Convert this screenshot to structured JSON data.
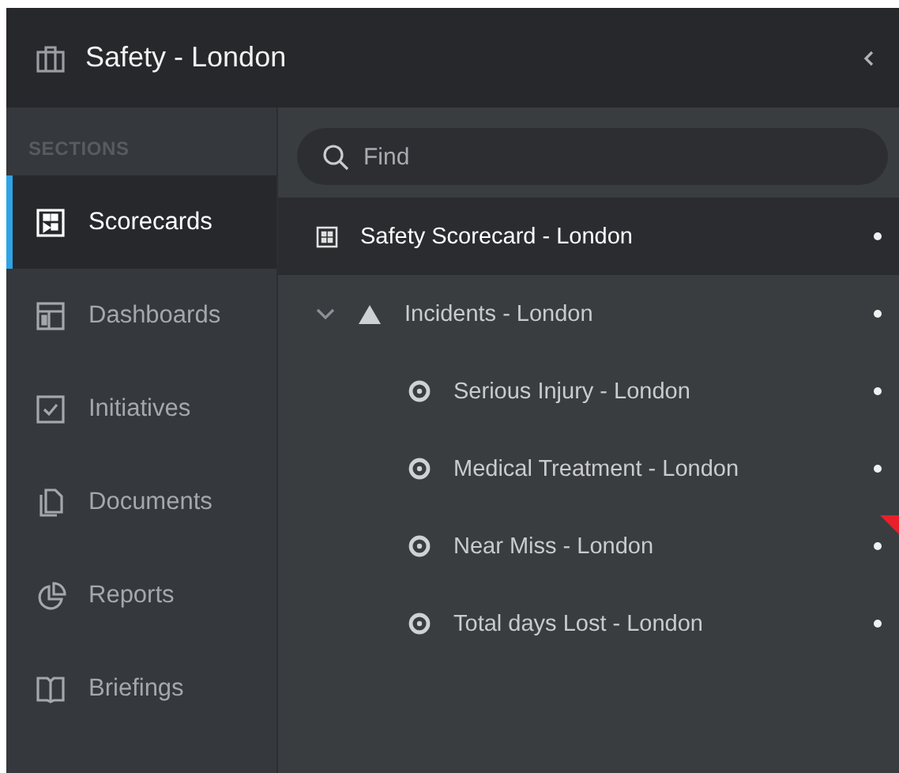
{
  "header": {
    "title": "Safety - London"
  },
  "sidebar": {
    "heading": "SECTIONS",
    "items": [
      {
        "label": "Scorecards",
        "kind": "scorecards",
        "selected": true
      },
      {
        "label": "Dashboards",
        "kind": "dashboards",
        "selected": false
      },
      {
        "label": "Initiatives",
        "kind": "initiatives",
        "selected": false
      },
      {
        "label": "Documents",
        "kind": "documents",
        "selected": false
      },
      {
        "label": "Reports",
        "kind": "reports",
        "selected": false
      },
      {
        "label": "Briefings",
        "kind": "briefings",
        "selected": false
      }
    ]
  },
  "search": {
    "placeholder": "Find"
  },
  "scorecard": {
    "label": "Safety Scorecard - London",
    "selected": true
  },
  "tree": [
    {
      "label": "Incidents - London",
      "kind": "objective",
      "expanded": true,
      "flagged": false,
      "children": [
        {
          "label": "Serious Injury - London",
          "kind": "measure",
          "flagged": false
        },
        {
          "label": "Medical Treatment - London",
          "kind": "measure",
          "flagged": false
        },
        {
          "label": "Near Miss - London",
          "kind": "measure",
          "flagged": true
        },
        {
          "label": "Total days Lost - London",
          "kind": "measure",
          "flagged": false
        }
      ]
    }
  ]
}
